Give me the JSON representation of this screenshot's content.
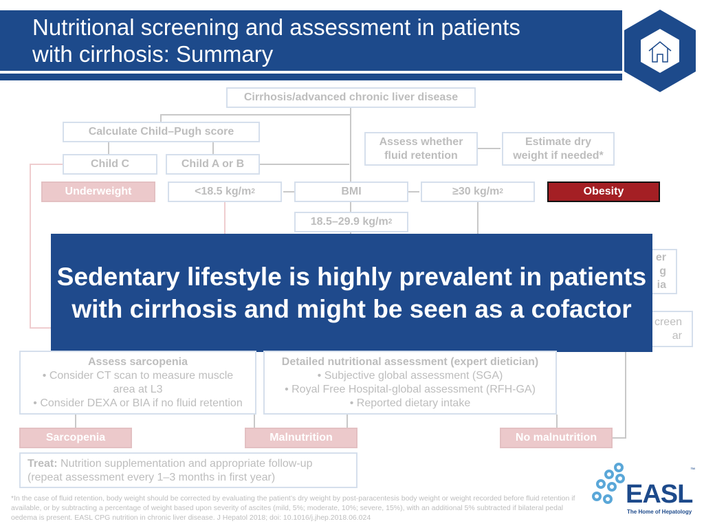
{
  "header": {
    "title_line1": "Nutritional screening and assessment in patients",
    "title_line2": "with cirrhosis: Summary",
    "home_icon": "house-icon"
  },
  "flow": {
    "start": "Cirrhosis/advanced chronic liver disease",
    "child_pugh": "Calculate Child–Pugh score",
    "child_c": "Child C",
    "child_ab": "Child A or B",
    "fluid_1": "Assess whether",
    "fluid_2": "fluid retention",
    "dry_1": "Estimate dry",
    "dry_2": "weight if needed*",
    "underweight": "Underweight",
    "bmi_low": "<18.5 kg/m",
    "bmi": "BMI",
    "bmi_high": "≥30 kg/m",
    "obesity": "Obesity",
    "bmi_mid": "18.5–29.9 kg/m",
    "sq": "2",
    "partial_right_1a": "er",
    "partial_right_1b": "g",
    "partial_right_1c": "ia",
    "partial_right_2a": "creen",
    "partial_right_2b": "ar",
    "sarc_title": "Assess sarcopenia",
    "sarc_1": "• Consider CT scan to measure muscle",
    "sarc_2": "area at L3",
    "sarc_3": "• Consider DEXA or BIA if no fluid retention",
    "detail_title": "Detailed nutritional assessment (expert dietician)",
    "detail_1": "•  Subjective global assessment (SGA)",
    "detail_2": "•  Royal Free Hospital-global assessment (RFH-GA)",
    "detail_3": "•  Reported dietary intake",
    "sarcopenia": "Sarcopenia",
    "malnutrition": "Malnutrition",
    "no_malnutrition": "No malnutrition",
    "treat_label": "Treat:",
    "treat_1": " Nutrition supplementation and appropriate follow-up",
    "treat_2": "(repeat assessment every 1–3 months in first year)"
  },
  "overlay": {
    "text": "Sedentary lifestyle is highly prevalent in patients with cirrhosis and might be seen as a cofactor"
  },
  "footnote": "*In the case of fluid retention, body weight should be corrected by evaluating the patient’s dry weight by post-paracentesis body weight or weight recorded before fluid retention if available, or by subtracting a percentage of weight based upon severity of ascites (mild, 5%; moderate, 10%; severe, 15%), with an additional 5% subtracted if bilateral pedal oedema is present. EASL CPG nutrition in chronic liver disease. J Hepatol 2018; doi: 10.1016/j.jhep.2018.06.024",
  "logo": {
    "name": "EASL",
    "tagline": "The Home of Hepatology",
    "tm": "™"
  },
  "colors": {
    "brand_blue": "#1d4a8b",
    "obesity_red": "#a41f24",
    "faded_pink": "#ecc9cb",
    "logo_light_blue": "#5aa7d8"
  }
}
